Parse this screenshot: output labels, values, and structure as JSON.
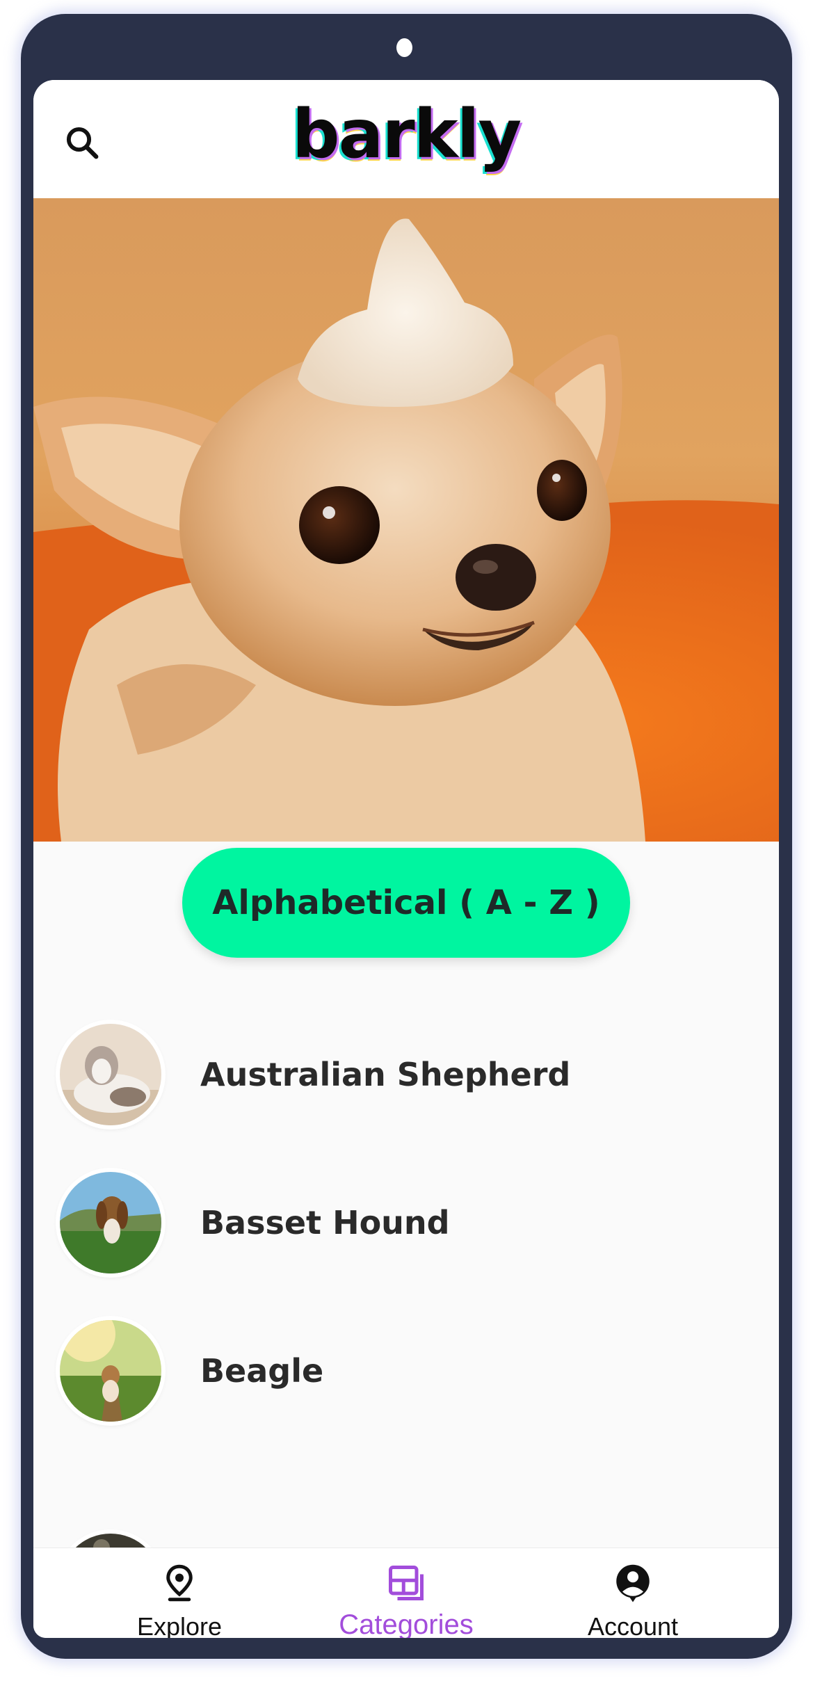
{
  "header": {
    "logo_text": "barkly",
    "search_icon": "search-icon"
  },
  "sort": {
    "label": "Alphabetical ( A - Z )"
  },
  "breeds": [
    {
      "name": "Australian Shepherd"
    },
    {
      "name": "Basset Hound"
    },
    {
      "name": "Beagle"
    }
  ],
  "nav": {
    "items": [
      {
        "label": "Explore",
        "icon": "location-pin-icon"
      },
      {
        "label": "Categories",
        "icon": "categories-icon",
        "active": true
      },
      {
        "label": "Account",
        "icon": "account-icon"
      }
    ]
  },
  "colors": {
    "device": "#2a3149",
    "accent_button": "#00f5a0",
    "active_nav": "#a24ddb",
    "text_dark": "#2a2a2a"
  }
}
